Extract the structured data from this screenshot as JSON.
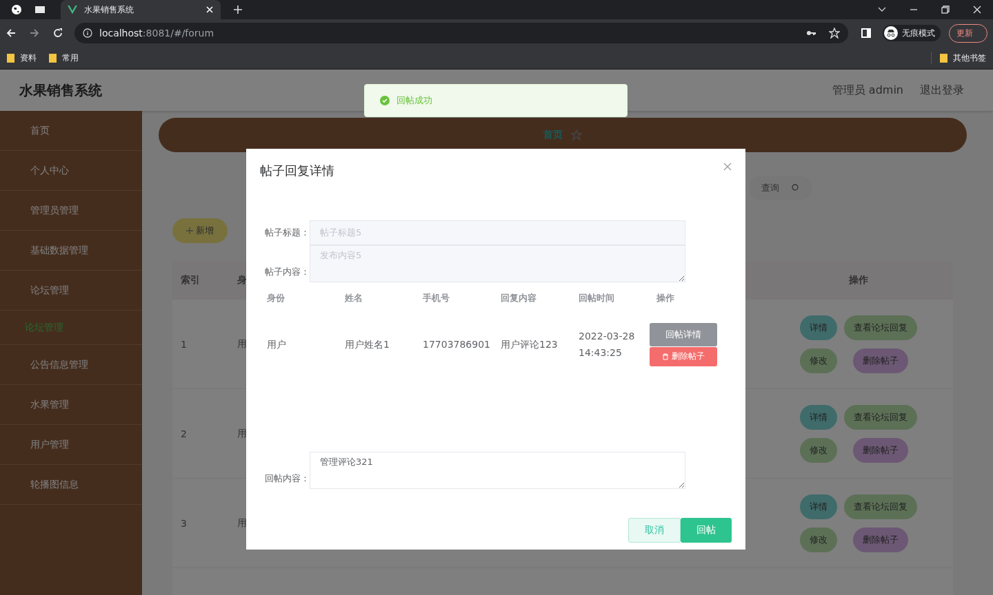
{
  "browser": {
    "tab_title": "水果销售系统",
    "url_host": "localhost",
    "url_rest": ":8081/#/forum",
    "bookmarks": [
      "资料",
      "常用"
    ],
    "other_bookmarks": "其他书签",
    "incognito": "无痕模式",
    "update": "更新"
  },
  "header": {
    "title": "水果销售系统",
    "user": "管理员 admin",
    "logout": "退出登录"
  },
  "sidebar": [
    {
      "label": "首页",
      "selected": false
    },
    {
      "label": "个人中心",
      "selected": false
    },
    {
      "label": "管理员管理",
      "selected": false
    },
    {
      "label": "基础数据管理",
      "selected": false
    },
    {
      "label": "论坛管理",
      "selected": false,
      "children": [
        {
          "label": "论坛管理",
          "selected": true
        }
      ]
    },
    {
      "label": "公告信息管理",
      "selected": false
    },
    {
      "label": "水果管理",
      "selected": false
    },
    {
      "label": "用户管理",
      "selected": false
    },
    {
      "label": "轮播图信息",
      "selected": false
    }
  ],
  "breadcrumb": "首页",
  "search_button": "查询",
  "add_button": "新增",
  "table": {
    "columns": [
      "索引",
      "身"
    ],
    "actions_column": "操作",
    "rows": [
      {
        "index": "1",
        "identity": "用",
        "actions": [
          "详情",
          "查看论坛回复",
          "修改",
          "删除帖子"
        ]
      },
      {
        "index": "2",
        "identity": "用",
        "actions": [
          "详情",
          "查看论坛回复",
          "修改",
          "删除帖子"
        ]
      },
      {
        "index": "3",
        "identity": "用",
        "actions": [
          "详情",
          "查看论坛回复",
          "修改",
          "删除帖子"
        ]
      }
    ]
  },
  "toast": "回帖成功",
  "dialog": {
    "title": "帖子回复详情",
    "fields": [
      {
        "label": "帖子标题：",
        "value": "帖子标题5",
        "kind": "input"
      },
      {
        "label": "帖子内容：",
        "value": "发布内容5",
        "kind": "textarea"
      }
    ],
    "columns": [
      "身份",
      "姓名",
      "手机号",
      "回复内容",
      "回帖时间",
      "操作"
    ],
    "rows": [
      {
        "cells": [
          "用户",
          "用户姓名1",
          "17703786901",
          "用户评论123",
          "2022-03-28 14:43:25"
        ],
        "actions": [
          "回帖详情",
          "删除帖子"
        ]
      }
    ],
    "reply_label": "回帖内容：",
    "reply_value": "管理评论321",
    "cancel": "取消",
    "submit": "回帖"
  }
}
